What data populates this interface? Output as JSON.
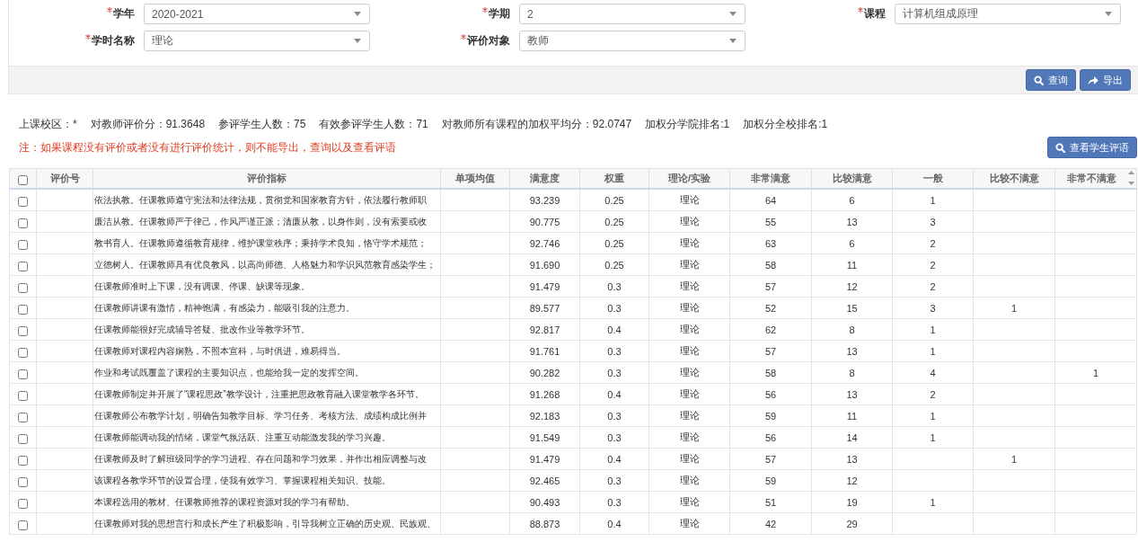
{
  "filters": [
    {
      "label": "学年",
      "required": true,
      "value": "2020-2021"
    },
    {
      "label": "学期",
      "required": true,
      "value": "2"
    },
    {
      "label": "课程",
      "required": true,
      "value": "计算机组成原理"
    },
    {
      "label": "学时名称",
      "required": true,
      "value": "理论"
    },
    {
      "label": "评价对象",
      "required": true,
      "value": "教师"
    }
  ],
  "toolbar_buttons": [
    {
      "kind": "search",
      "label": "查询"
    },
    {
      "kind": "export",
      "label": "导出"
    }
  ],
  "stats": [
    "上课校区：*",
    "对教师评价分：91.3648",
    "参评学生人数：75",
    "有效参评学生人数：71",
    "对教师所有课程的加权平均分：92.0747",
    "加权分学院排名:1",
    "加权分全校排名:1"
  ],
  "note": "注：如果课程没有评价或者没有进行评价统计，则不能导出，查询以及查看评语",
  "comments_button": {
    "kind": "search",
    "label": "查看学生评语"
  },
  "table": {
    "select_all_checked": false,
    "columns": [
      "评价号",
      "评价指标",
      "单项均值",
      "满意度",
      "权重",
      "理论/实验",
      "非常满意",
      "比较满意",
      "一般",
      "比较不满意",
      "非常不满意"
    ],
    "rows": [
      {
        "checked": false,
        "indicator": "依法执教。任课教师遵守宪法和法律法规，贯彻党和国家教育方针，依法履行教师职",
        "satisfaction": "93.239",
        "weight": "0.25",
        "type": "理论",
        "very_satisfied": "64",
        "satisfied": "6",
        "neutral": "1"
      },
      {
        "checked": false,
        "indicator": "廉洁从教。任课教师严于律己，作风严谨正派；清廉从教，以身作则，没有索要或收",
        "satisfaction": "90.775",
        "weight": "0.25",
        "type": "理论",
        "very_satisfied": "55",
        "satisfied": "13",
        "neutral": "3"
      },
      {
        "checked": false,
        "indicator": "教书育人。任课教师遵循教育规律，维护课堂秩序；秉持学术良知，恪守学术规范；",
        "satisfaction": "92.746",
        "weight": "0.25",
        "type": "理论",
        "very_satisfied": "63",
        "satisfied": "6",
        "neutral": "2"
      },
      {
        "checked": false,
        "indicator": "立德树人。任课教师具有优良教风，以高尚师德、人格魅力和学识风范教育感染学生；",
        "satisfaction": "91.690",
        "weight": "0.25",
        "type": "理论",
        "very_satisfied": "58",
        "satisfied": "11",
        "neutral": "2"
      },
      {
        "checked": false,
        "indicator": "任课教师准时上下课，没有调课、停课、缺课等现象。",
        "satisfaction": "91.479",
        "weight": "0.3",
        "type": "理论",
        "very_satisfied": "57",
        "satisfied": "12",
        "neutral": "2"
      },
      {
        "checked": false,
        "indicator": "任课教师讲课有激情，精神饱满，有感染力，能吸引我的注意力。",
        "satisfaction": "89.577",
        "weight": "0.3",
        "type": "理论",
        "very_satisfied": "52",
        "satisfied": "15",
        "neutral": "3",
        "dissatisfied": "1"
      },
      {
        "checked": false,
        "indicator": "任课教师能很好完成辅导答疑、批改作业等教学环节。",
        "satisfaction": "92.817",
        "weight": "0.4",
        "type": "理论",
        "very_satisfied": "62",
        "satisfied": "8",
        "neutral": "1"
      },
      {
        "checked": false,
        "indicator": "任课教师对课程内容娴熟，不照本宣科，与时俱进，难易得当。",
        "satisfaction": "91.761",
        "weight": "0.3",
        "type": "理论",
        "very_satisfied": "57",
        "satisfied": "13",
        "neutral": "1"
      },
      {
        "checked": false,
        "indicator": "作业和考试既覆盖了课程的主要知识点，也能给我一定的发挥空间。",
        "satisfaction": "90.282",
        "weight": "0.3",
        "type": "理论",
        "very_satisfied": "58",
        "satisfied": "8",
        "neutral": "4",
        "very_dissatisfied": "1"
      },
      {
        "checked": false,
        "indicator": "任课教师制定并开展了“课程思政”教学设计，注重把思政教育融入课堂教学各环节。",
        "satisfaction": "91.268",
        "weight": "0.4",
        "type": "理论",
        "very_satisfied": "56",
        "satisfied": "13",
        "neutral": "2"
      },
      {
        "checked": false,
        "indicator": "任课教师公布教学计划，明确告知教学目标、学习任务、考核方法、成绩构成比例并",
        "satisfaction": "92.183",
        "weight": "0.3",
        "type": "理论",
        "very_satisfied": "59",
        "satisfied": "11",
        "neutral": "1"
      },
      {
        "checked": false,
        "indicator": "任课教师能调动我的情绪，课堂气氛活跃、注重互动能激发我的学习兴趣。",
        "satisfaction": "91.549",
        "weight": "0.3",
        "type": "理论",
        "very_satisfied": "56",
        "satisfied": "14",
        "neutral": "1"
      },
      {
        "checked": false,
        "indicator": "任课教师及时了解班级同学的学习进程、存在问题和学习效果，并作出相应调整与改",
        "satisfaction": "91.479",
        "weight": "0.4",
        "type": "理论",
        "very_satisfied": "57",
        "satisfied": "13",
        "dissatisfied": "1"
      },
      {
        "checked": false,
        "indicator": "该课程各教学环节的设置合理，使我有效学习、掌握课程相关知识、技能。",
        "satisfaction": "92.465",
        "weight": "0.3",
        "type": "理论",
        "very_satisfied": "59",
        "satisfied": "12"
      },
      {
        "checked": false,
        "indicator": "本课程选用的教材、任课教师推荐的课程资源对我的学习有帮助。",
        "satisfaction": "90.493",
        "weight": "0.3",
        "type": "理论",
        "very_satisfied": "51",
        "satisfied": "19",
        "neutral": "1"
      },
      {
        "checked": false,
        "indicator": "任课教师对我的思想言行和成长产生了积极影响，引导我树立正确的历史观、民族观、",
        "satisfaction": "88.873",
        "weight": "0.4",
        "type": "理论",
        "very_satisfied": "42",
        "satisfied": "29"
      }
    ]
  }
}
